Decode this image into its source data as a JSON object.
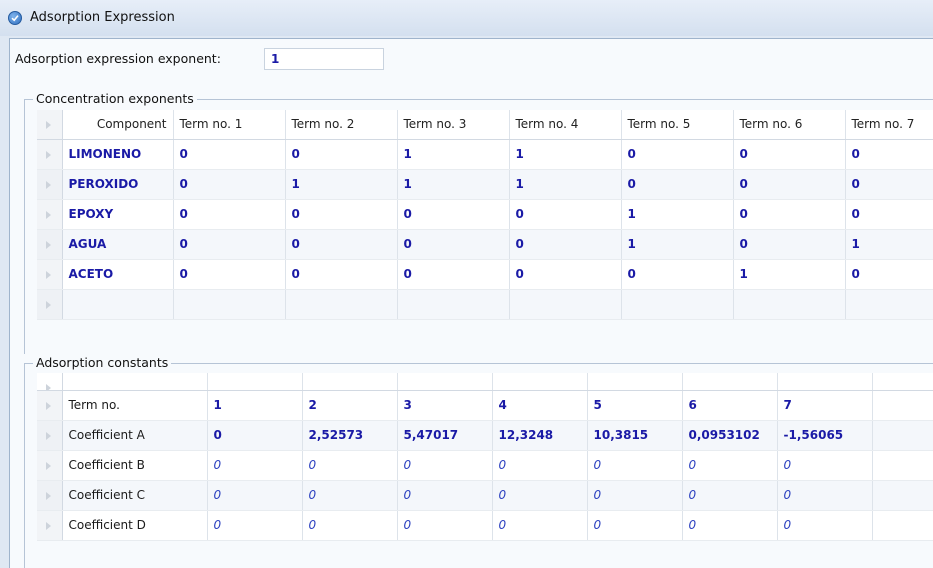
{
  "window": {
    "title": "Adsorption Expression"
  },
  "exponent": {
    "label": "Adsorption expression exponent:",
    "value": "1"
  },
  "concentration": {
    "legend": "Concentration exponents",
    "component_header": "Component",
    "term_headers": [
      "Term no. 1",
      "Term no. 2",
      "Term no. 3",
      "Term no. 4",
      "Term no. 5",
      "Term no. 6",
      "Term no. 7"
    ],
    "rows": [
      {
        "component": "LIMONENO",
        "values": [
          "0",
          "0",
          "1",
          "1",
          "0",
          "0",
          "0"
        ]
      },
      {
        "component": "PEROXIDO",
        "values": [
          "0",
          "1",
          "1",
          "1",
          "0",
          "0",
          "0"
        ]
      },
      {
        "component": "EPOXY",
        "values": [
          "0",
          "0",
          "0",
          "0",
          "1",
          "0",
          "0"
        ]
      },
      {
        "component": "AGUA",
        "values": [
          "0",
          "0",
          "0",
          "0",
          "1",
          "0",
          "1"
        ]
      },
      {
        "component": "ACETO",
        "values": [
          "0",
          "0",
          "0",
          "0",
          "0",
          "1",
          "0"
        ]
      }
    ]
  },
  "constants": {
    "legend": "Adsorption constants",
    "rows": [
      {
        "label": "Term no.",
        "values": [
          "1",
          "2",
          "3",
          "4",
          "5",
          "6",
          "7"
        ]
      },
      {
        "label": "Coefficient A",
        "values": [
          "0",
          "2,52573",
          "5,47017",
          "12,3248",
          "10,3815",
          "0,0953102",
          "-1,56065"
        ]
      },
      {
        "label": "Coefficient B",
        "values": [
          "0",
          "0",
          "0",
          "0",
          "0",
          "0",
          "0"
        ]
      },
      {
        "label": "Coefficient C",
        "values": [
          "0",
          "0",
          "0",
          "0",
          "0",
          "0",
          "0"
        ]
      },
      {
        "label": "Coefficient D",
        "values": [
          "0",
          "0",
          "0",
          "0",
          "0",
          "0",
          "0"
        ]
      }
    ]
  }
}
